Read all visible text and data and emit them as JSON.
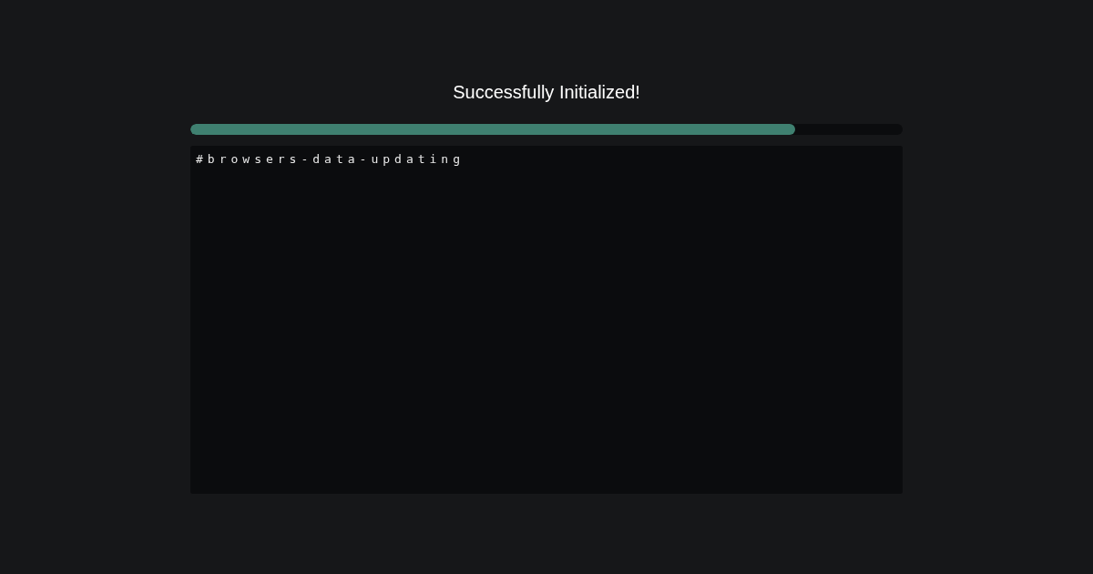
{
  "title": "Successfully Initialized!",
  "progress": {
    "level": 0.849
  },
  "log": {
    "lines": [
      "#browsers-data-updating"
    ]
  }
}
